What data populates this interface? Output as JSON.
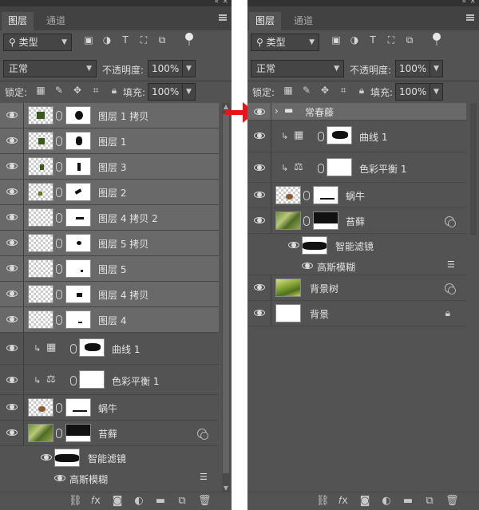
{
  "header": {
    "collapse": "«",
    "close": "×"
  },
  "tabs": [
    {
      "label": "图层"
    },
    {
      "label": "通道"
    }
  ],
  "filter": {
    "kind_label": "类型",
    "kind_icon": "search-icon"
  },
  "blend": {
    "mode": "正常",
    "opacity_label": "不透明度:",
    "opacity_value": "100%"
  },
  "lock": {
    "label": "锁定:",
    "fill_label": "填充:",
    "fill_value": "100%"
  },
  "left_layers": [
    {
      "name": "图层 1 拷贝",
      "selected": true
    },
    {
      "name": "图层 1",
      "selected": true
    },
    {
      "name": "图层 3",
      "selected": true
    },
    {
      "name": "图层 2",
      "selected": true
    },
    {
      "name": "图层 4 拷贝 2",
      "selected": true
    },
    {
      "name": "图层 5 拷贝",
      "selected": true
    },
    {
      "name": "图层 5",
      "selected": true
    },
    {
      "name": "图层 4 拷贝",
      "selected": true
    },
    {
      "name": "图层 4",
      "selected": true
    },
    {
      "name": "曲线 1",
      "selected": false
    },
    {
      "name": "色彩平衡 1",
      "selected": false
    },
    {
      "name": "蜗牛",
      "selected": false
    },
    {
      "name": "苔藓",
      "selected": false
    },
    {
      "name": "智能滤镜",
      "selected": false
    },
    {
      "name": "高斯模糊",
      "selected": false
    }
  ],
  "right_layers": [
    {
      "name": "常春藤"
    },
    {
      "name": "曲线 1"
    },
    {
      "name": "色彩平衡 1"
    },
    {
      "name": "蜗牛"
    },
    {
      "name": "苔藓"
    },
    {
      "name": "智能滤镜"
    },
    {
      "name": "高斯模糊"
    },
    {
      "name": "背景树"
    },
    {
      "name": "背景"
    }
  ],
  "colors": {
    "panel": "#535353",
    "selected": "#696969",
    "arrow": "#e8141c"
  }
}
